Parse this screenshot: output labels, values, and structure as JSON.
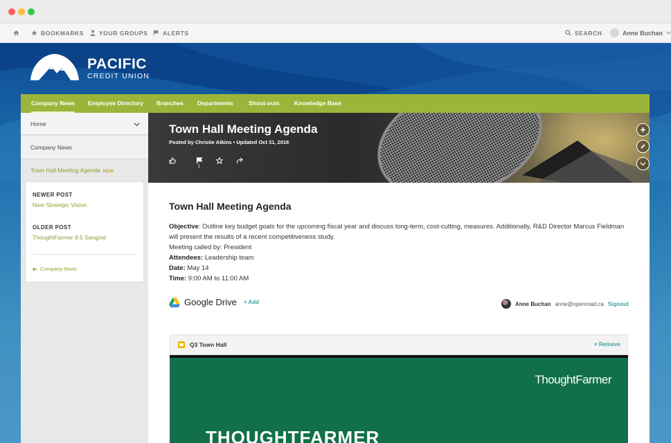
{
  "topnav": {
    "bookmarks": "BOOKMARKS",
    "groups": "YOUR GROUPS",
    "alerts": "ALERTS",
    "search": "SEARCH",
    "user": "Anne Buchan"
  },
  "logo": {
    "line1": "PACIFIC",
    "line2": "CREDIT UNION"
  },
  "mainnav": [
    "Company News",
    "Employee Directory",
    "Branches",
    "Departments",
    "Shout-outs",
    "Knowledge Base"
  ],
  "sidebar": {
    "home": "Home",
    "company_news": "Company News",
    "current": "Town Hall Meeting Agenda",
    "new_badge": "NEW",
    "newer_label": "NEWER POST",
    "newer_link": "New Strategic Vision",
    "older_label": "OLDER POST",
    "older_link": "ThoughtFarmer 8.5 Sangria!",
    "back": "Company News"
  },
  "banner": {
    "title": "Town Hall Meeting Agenda",
    "meta": "Posted by Christie Atkins  •  Updated Oct 31, 2018",
    "flag_count": "1"
  },
  "post": {
    "title": "Town Hall Meeting Agenda",
    "objective_label": "Objective",
    "objective_text": ": Outline key budget goals for the upcoming fiscal year and discuss long-term, cost-cutting, measures. Additionally, R&D Director Marcus Fieldman will present the results of a recent competitiveness study.",
    "called_by": "Meeting called by: President",
    "attendees_label": "Attendees:",
    "attendees_value": " Leadership team",
    "date_label": "Date:",
    "date_value": " May 14",
    "time_label": "Time:",
    "time_value": " 9:00 AM to 11:00 AM"
  },
  "gdrive": {
    "title": "Google Drive",
    "add": "+ Add",
    "user_name": "Anne Buchan",
    "user_email": "anne@openroad.ca",
    "signout": "Signout"
  },
  "file": {
    "name": "Q3 Town Hall",
    "remove": "Remove",
    "preview_logo": "ThoughtFarmer",
    "preview_heading": "THOUGHTFARMER"
  },
  "colors": {
    "accent_green": "#9bb53a",
    "link_green": "#8aa22c",
    "teal": "#3aa3a0",
    "hero_blue": "#0d4c95",
    "preview_green": "#11704a"
  }
}
